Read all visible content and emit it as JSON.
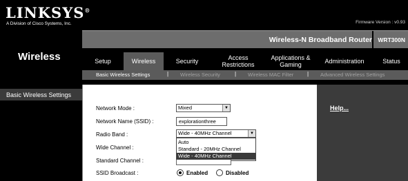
{
  "brand": {
    "logo": "LINKSYS",
    "registered": "®",
    "subtitle": "A Division of Cisco Systems, Inc.",
    "firmware": "Firmware Version : v0.93"
  },
  "product": {
    "name": "Wireless-N Broadband Router",
    "model": "WRT300N"
  },
  "section_title": "Wireless",
  "tabs": [
    {
      "label": "Setup"
    },
    {
      "label": "Wireless"
    },
    {
      "label": "Security"
    },
    {
      "label": "Access Restrictions"
    },
    {
      "label": "Applications & Gaming"
    },
    {
      "label": "Administration"
    },
    {
      "label": "Status"
    }
  ],
  "subtabs": [
    {
      "label": "Basic Wireless Settings"
    },
    {
      "label": "Wireless Security"
    },
    {
      "label": "Wireless MAC Filter"
    },
    {
      "label": "Advanced Wireless Settings"
    }
  ],
  "subtab_separator": "|",
  "left_label": "Basic Wireless Settings",
  "help": "Help...",
  "form": {
    "network_mode": {
      "label": "Network Mode :",
      "value": "Mixed"
    },
    "ssid": {
      "label": "Network Name (SSID) :",
      "value": "explorationthree"
    },
    "radio_band": {
      "label": "Radio Band :",
      "value": "Wide - 40MHz Channel"
    },
    "radio_band_options": [
      "Auto",
      "Standard - 20MHz Channel",
      "Wide - 40MHz Channel"
    ],
    "wide_channel": {
      "label": "Wide Channel :"
    },
    "standard_channel": {
      "label": "Standard Channel :"
    },
    "ssid_broadcast": {
      "label": "SSID Broadcast :",
      "enabled": "Enabled",
      "disabled": "Disabled",
      "selected": "Enabled"
    }
  }
}
